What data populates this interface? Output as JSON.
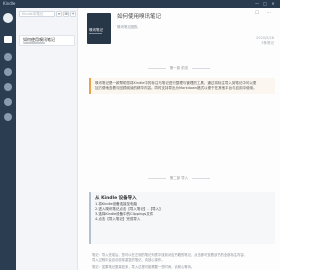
{
  "window": {
    "app_name": "Kindle",
    "controls": [
      "—",
      "□",
      "✕"
    ]
  },
  "list": {
    "search_placeholder": "Kindle本笔记",
    "buttons": [
      "≡",
      "⊞",
      "+"
    ],
    "items": [
      {
        "title": "如何使用嗅讯笔记"
      }
    ]
  },
  "main": {
    "top_icons": "☐ ⋯",
    "book": {
      "cover_title": "嗅讯笔记"
    },
    "title": "如何使用嗅讯笔记",
    "meta": "嗅讯笔记团队",
    "info": [
      "2020/5/28",
      "3条笔记"
    ],
    "sections": {
      "intro_label": "第一部 前言",
      "import_label": "第二部 导入"
    },
    "intro_lines": [
      "嗅讯笔记是一款帮助您将Kindle中的标注与笔记进行整理与管理的工具，通过将标注导入到笔记中可以更",
      "加方便地查看与回顾阅读的精华内容。同时支持导出为Markdown格式以便于在其他平台与应用中使用。"
    ],
    "steps": {
      "heading": "从 Kindle 设备导入",
      "lines": [
        "1.将Kindle设备连接至电脑",
        "2.进入嗅讯笔记点击【导入笔记】-【导入】",
        "3.选择Kindle设备中的Clippings文件",
        "4.点击【导入笔记】完成导入"
      ]
    },
    "notes": [
      "笔记：导入完成后，您可以在左侧的笔记列表中找到对应书籍的笔记，点击即可查看该书的全部标注内容。",
      "导入过程中会自动去除重复的笔记，请放心操作。",
      "笔记：如果笔记数量较多，导入过程可能需要一些时间，请耐心等待。"
    ]
  },
  "colors": {
    "rail": "#2b3d51",
    "titlebar": "#2a3b4f",
    "accent": "#e8a44a"
  }
}
